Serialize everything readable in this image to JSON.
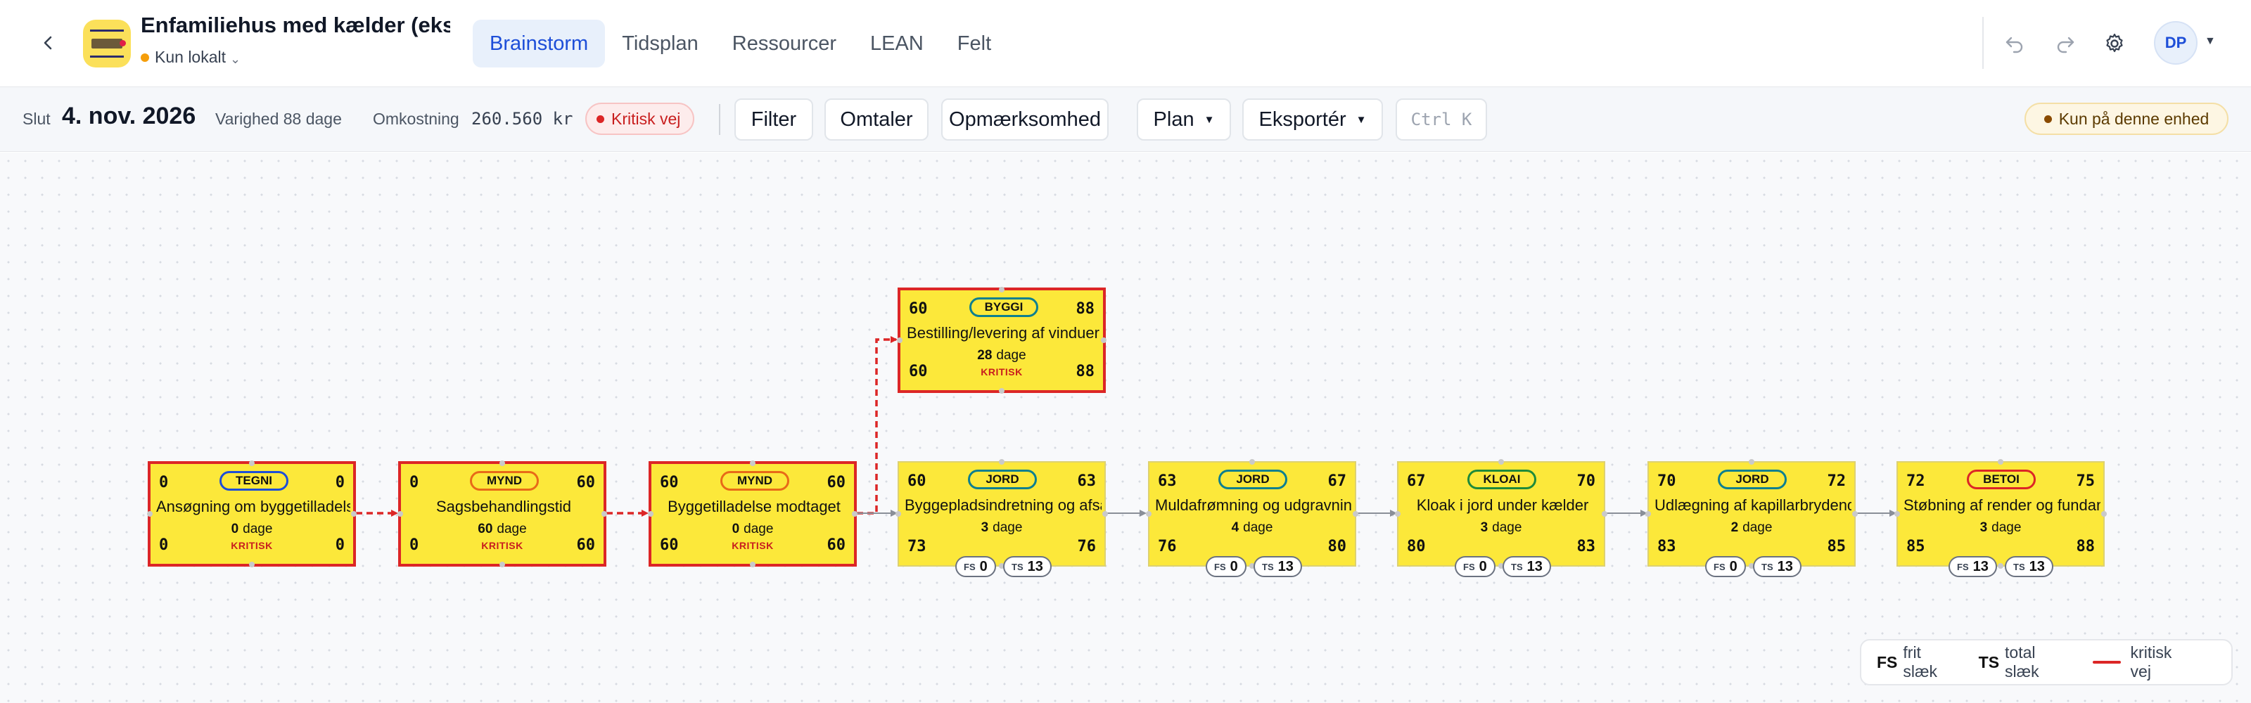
{
  "header": {
    "project_title": "Enfamiliehus med kælder (ekse…",
    "storage_status": "Kun lokalt",
    "storage_chevron": "⌄",
    "tabs": [
      {
        "label": "Brainstorm",
        "active": true
      },
      {
        "label": "Tidsplan",
        "active": false
      },
      {
        "label": "Ressourcer",
        "active": false
      },
      {
        "label": "LEAN",
        "active": false
      },
      {
        "label": "Felt",
        "active": false
      }
    ],
    "user_initials": "DP",
    "icons": [
      "back-icon",
      "undo-icon",
      "redo-icon",
      "gear-icon",
      "chevron-down-icon"
    ]
  },
  "toolbar": {
    "end_label": "Slut",
    "end_value": "4. nov. 2026",
    "duration_text": "Varighed 88 dage",
    "cost_label": "Omkostning",
    "cost_value": "260.560 kr",
    "critical_badge": "Kritisk vej",
    "filter_label": "Filter",
    "comments_label": "Omtaler",
    "attention_label": "Opmærksomhed",
    "plan_label": "Plan",
    "export_label": "Eksportér",
    "search_placeholder": "Ctrl K",
    "local_badge": "Kun på denne enhed"
  },
  "canvas": {
    "nodes": [
      {
        "id": "n1",
        "tag": "TEGNI",
        "tag_color": "blue",
        "name": "Ansøgning om byggetilladelse",
        "duration_value": "0",
        "duration_unit": "dage",
        "es": "0",
        "ef": "0",
        "ls": "0",
        "lf": "0",
        "critical": true,
        "critical_label": "KRITISK"
      },
      {
        "id": "n2",
        "tag": "MYND",
        "tag_color": "orange",
        "name": "Sagsbehandlingstid",
        "duration_value": "60",
        "duration_unit": "dage",
        "es": "0",
        "ef": "60",
        "ls": "0",
        "lf": "60",
        "critical": true,
        "critical_label": "KRITISK"
      },
      {
        "id": "n3",
        "tag": "MYND",
        "tag_color": "orange",
        "name": "Byggetilladelse modtaget",
        "duration_value": "0",
        "duration_unit": "dage",
        "es": "60",
        "ef": "60",
        "ls": "60",
        "lf": "60",
        "critical": true,
        "critical_label": "KRITISK"
      },
      {
        "id": "n4",
        "tag": "BYGGI",
        "tag_color": "teal",
        "name": "Bestilling/levering af vinduer",
        "duration_value": "28",
        "duration_unit": "dage",
        "es": "60",
        "ef": "88",
        "ls": "60",
        "lf": "88",
        "critical": true,
        "critical_label": "KRITISK"
      },
      {
        "id": "n5",
        "tag": "JORD",
        "tag_color": "teal",
        "name": "Byggepladsindretning og afsætning",
        "duration_value": "3",
        "duration_unit": "dage",
        "es": "60",
        "ef": "63",
        "ls": "73",
        "lf": "76",
        "critical": false,
        "fs": "0",
        "ts": "13"
      },
      {
        "id": "n6",
        "tag": "JORD",
        "tag_color": "teal",
        "name": "Muldafrømning og udgravning",
        "duration_value": "4",
        "duration_unit": "dage",
        "es": "63",
        "ef": "67",
        "ls": "76",
        "lf": "80",
        "critical": false,
        "fs": "0",
        "ts": "13"
      },
      {
        "id": "n7",
        "tag": "KLOAI",
        "tag_color": "green",
        "name": "Kloak i jord under kælder",
        "duration_value": "3",
        "duration_unit": "dage",
        "es": "67",
        "ef": "70",
        "ls": "80",
        "lf": "83",
        "critical": false,
        "fs": "0",
        "ts": "13"
      },
      {
        "id": "n8",
        "tag": "JORD",
        "tag_color": "teal",
        "name": "Udlægning af kapillarbrydende lag",
        "duration_value": "2",
        "duration_unit": "dage",
        "es": "70",
        "ef": "72",
        "ls": "83",
        "lf": "85",
        "critical": false,
        "fs": "0",
        "ts": "13"
      },
      {
        "id": "n9",
        "tag": "BETOI",
        "tag_color": "red",
        "name": "Støbning af render og fundamenter",
        "duration_value": "3",
        "duration_unit": "dage",
        "es": "72",
        "ef": "75",
        "ls": "85",
        "lf": "88",
        "critical": false,
        "fs": "13",
        "ts": "13"
      }
    ],
    "slack_labels": {
      "fs": "FS",
      "ts": "TS"
    },
    "legend": {
      "fs_abbr": "FS",
      "fs_text": "frit slæk",
      "ts_abbr": "TS",
      "ts_text": "total slæk",
      "crit_text": "kritisk vej"
    },
    "colors": {
      "node_fill": "#fce83a",
      "critical": "#dc2626",
      "accent": "#1d4ed8",
      "edge": "#8a8f98"
    }
  }
}
